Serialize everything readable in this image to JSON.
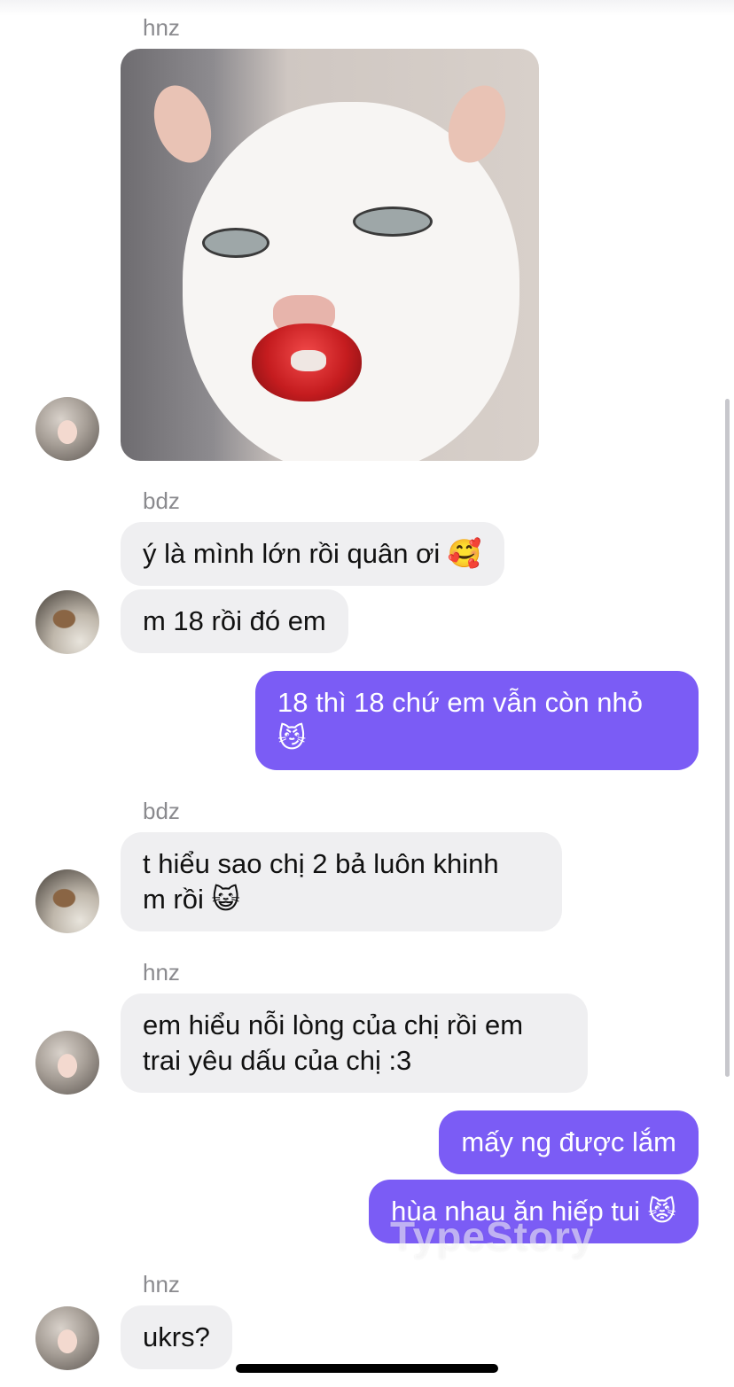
{
  "messages": [
    {
      "sender": "hnz",
      "type": "image"
    },
    {
      "sender": "bdz",
      "texts": [
        "ý là mình lớn rồi quân ơi 🥰",
        "m 18 rồi đó em"
      ]
    },
    {
      "sender": "me",
      "texts": [
        "18 thì 18 chứ em vẫn còn nhỏ\n😼"
      ]
    },
    {
      "sender": "bdz",
      "texts": [
        "t hiểu sao chị 2 bả luôn khinh\nm rồi 😺"
      ]
    },
    {
      "sender": "hnz",
      "texts": [
        "em hiểu nỗi lòng của chị rồi em\ntrai yêu dấu của chị :3"
      ]
    },
    {
      "sender": "me",
      "texts": [
        "mấy ng được lắm",
        "hùa nhau ăn hiếp tui 😾"
      ]
    },
    {
      "sender": "hnz",
      "texts": [
        "ukrs?"
      ]
    }
  ],
  "watermark": "TypeStory",
  "colors": {
    "outgoing": "#7b5cf5",
    "incoming": "#efeff1",
    "sender_name": "#8a8a8e"
  }
}
